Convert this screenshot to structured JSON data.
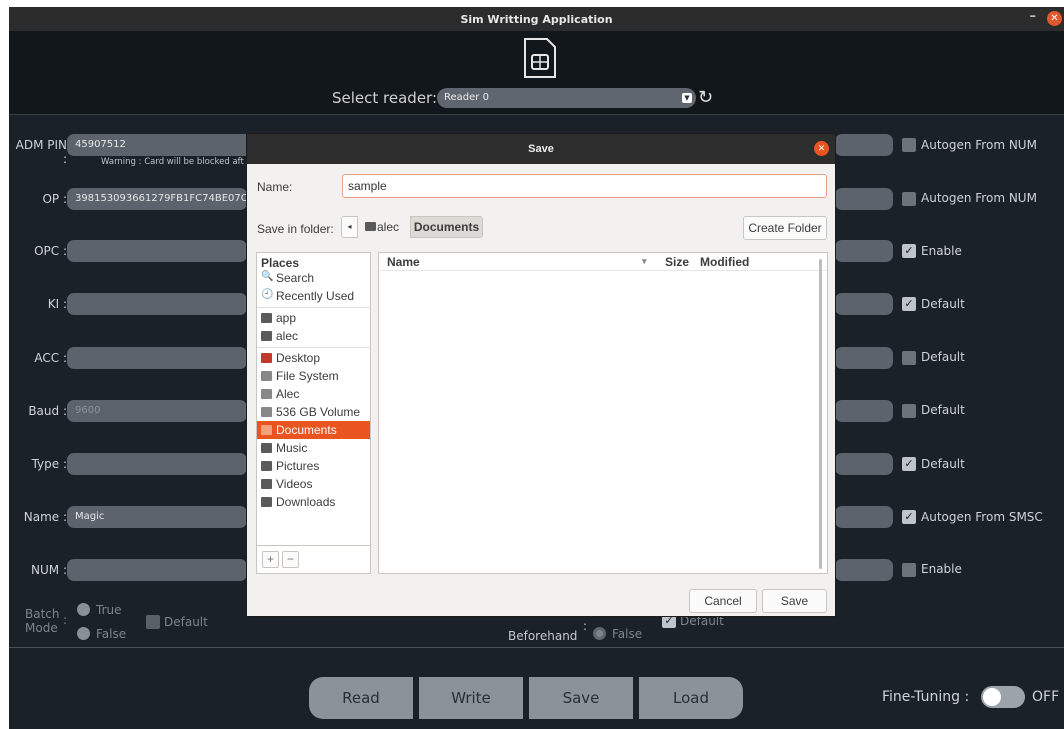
{
  "window": {
    "title": "Sim Writting Application",
    "minimize": "–",
    "close": "✕"
  },
  "reader": {
    "label": "Select reader:",
    "value": "Reader 0",
    "refresh_icon": "↻"
  },
  "fields": {
    "adm_pin": {
      "label": "ADM PIN :",
      "value": "45907512",
      "warning": "Warning : Card will be blocked aft"
    },
    "op": {
      "label": "OP :",
      "value": "398153093661279FB1FC74BE07C"
    },
    "opc": {
      "label": "OPC :",
      "value": ""
    },
    "ki": {
      "label": "KI :",
      "value": ""
    },
    "acc": {
      "label": "ACC :",
      "value": ""
    },
    "baud": {
      "label": "Baud :",
      "value": "9600"
    },
    "type": {
      "label": "Type :",
      "value": ""
    },
    "name": {
      "label": "Name :",
      "value": "Magic"
    },
    "num": {
      "label": "NUM :",
      "value": ""
    }
  },
  "right_options": [
    {
      "label": "Autogen From NUM",
      "checked": false
    },
    {
      "label": "Autogen From NUM",
      "checked": false
    },
    {
      "label": "Enable",
      "checked": true
    },
    {
      "label": "Default",
      "checked": true
    },
    {
      "label": "Default",
      "checked": false
    },
    {
      "label": "Default",
      "checked": false
    },
    {
      "label": "Default",
      "checked": true
    },
    {
      "label": "Autogen From SMSC",
      "checked": true
    },
    {
      "label": "Enable",
      "checked": false
    }
  ],
  "batch": {
    "label_1": "Batch",
    "label_2": "Mode",
    "colon": ":",
    "true": "True",
    "false": "False",
    "default": "Default"
  },
  "beforehand": {
    "label": "Beforehand",
    "colon": ":",
    "false": "False",
    "default": "Default"
  },
  "buttons": {
    "read": "Read",
    "write": "Write",
    "save": "Save",
    "load": "Load"
  },
  "fine_tuning": {
    "label": "Fine-Tuning :",
    "state": "OFF"
  },
  "dialog": {
    "title": "Save",
    "close": "✕",
    "name_label": "Name:",
    "name_value": "sample",
    "folder_label": "Save in folder:",
    "crumb_back": "◂",
    "crumb_parent": "alec",
    "crumb_current": "Documents",
    "create_folder": "Create Folder",
    "places_header": "Places",
    "places": [
      {
        "label": "Search",
        "icon": "search-icon",
        "glyph": "🔍"
      },
      {
        "label": "Recently Used",
        "icon": "clock-icon",
        "glyph": "🕘"
      },
      {
        "label": "app",
        "icon": "folder-icon"
      },
      {
        "label": "alec",
        "icon": "folder-icon"
      },
      {
        "label": "Desktop",
        "icon": "desktop-icon",
        "color": "#c0392b"
      },
      {
        "label": "File System",
        "icon": "drive-icon",
        "color": "#888888"
      },
      {
        "label": "Alec",
        "icon": "drive-icon",
        "color": "#888888"
      },
      {
        "label": "536 GB Volume",
        "icon": "drive-icon",
        "color": "#888888"
      },
      {
        "label": "Documents",
        "icon": "folder-icon",
        "selected": true
      },
      {
        "label": "Music",
        "icon": "folder-icon"
      },
      {
        "label": "Pictures",
        "icon": "folder-icon"
      },
      {
        "label": "Videos",
        "icon": "folder-icon"
      },
      {
        "label": "Downloads",
        "icon": "folder-icon"
      }
    ],
    "add": "+",
    "remove": "−",
    "columns": {
      "name": "Name",
      "sort": "▾",
      "size": "Size",
      "modified": "Modified"
    },
    "cancel": "Cancel",
    "save": "Save"
  }
}
